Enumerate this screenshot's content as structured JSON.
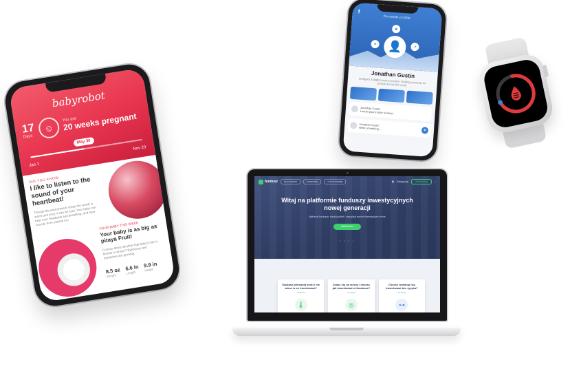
{
  "pregnancy_app": {
    "logo": "babyrobot",
    "days_number": "17",
    "days_label": "Days",
    "pregnancy_label": "You are",
    "pregnancy_weeks": "20 weeks pregnant",
    "progress_pill": "May 30",
    "progress_fraction": 0.48,
    "date_start": "Jan 1",
    "date_end": "Nov 20",
    "section_tag": "DID YOU KNOW",
    "headline": "I like to listen to the sound of your heartbeat!",
    "body_text": "Though the environment inside the womb is warm and cozy, it can be loud. Your baby can hear your heartbeat and breathing, and hear sounds from outside too.",
    "section_tag_2": "YOUR BABY THIS WEEK",
    "headline_2": "Your baby is as big as pitaya Fruit!",
    "body_text_2": "Curious about whether that baby's hair is blonde or brown? Eyebrows and eyelashes are growing.",
    "stats": [
      {
        "value": "8.5 oz",
        "label": "Weight"
      },
      {
        "value": "6.6 in",
        "label": "Length"
      },
      {
        "value": "9.9 in",
        "label": "Height"
      }
    ]
  },
  "profile_app": {
    "brand_icon": "f",
    "header_title": "Personal profile",
    "avatar_icon": "person-icon",
    "name": "Jonathan Gustin",
    "subtitle": "Designer & digital product creator. Building products for people across the world.",
    "feed": [
      {
        "author": "Jonathan Gustin",
        "text": "Lorem ipsum dolor sit amet"
      },
      {
        "author": "Jonathan Gustin",
        "text": "Write something..."
      }
    ]
  },
  "watch": {
    "progress_fraction": 0.7,
    "ring_color": "#e03a3e",
    "icon": "heart-drop-icon"
  },
  "laptop_site": {
    "logo": "fundusz",
    "nav_buttons": [
      "DLA KLIENTA",
      "FUNDUSZE",
      "O PLATFORMIE"
    ],
    "nav_login": "Zaloguj się",
    "nav_cta": "Załóż konto",
    "hero_title": "Witaj na platformie funduszy inwestycyjnych nowej generacji",
    "hero_subtitle": "Wybieraj fundusze, startuj portfel i zarządzaj swoimi inwestycjami online",
    "hero_button": "Załóż konto",
    "carousel_dots": "• • • •",
    "cards": [
      {
        "title": "Szukasz pierwszej kroki i nie wiesz w co inwestować?",
        "link": "Sprawdź",
        "icon": "thermometer-icon"
      },
      {
        "title": "Znasz się na rzeczy i chcesz jak inwestować w fundusze?",
        "link": "Sprawdź",
        "icon": "coins-icon"
      },
      {
        "title": "Chcesz rozwinąć się inwestować bez ryzyka?",
        "link": "Sprawdź",
        "icon": "dumbbell-icon"
      }
    ],
    "accent_color": "#3ecf6e"
  }
}
